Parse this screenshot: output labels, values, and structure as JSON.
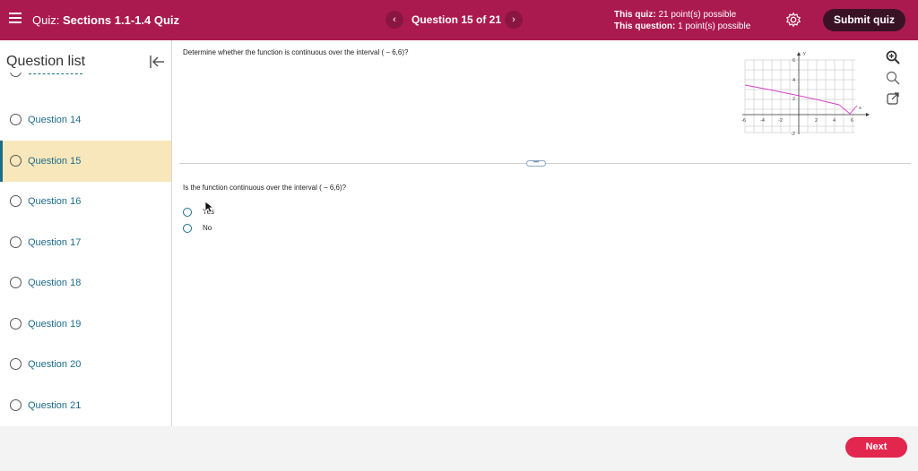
{
  "header": {
    "quiz_prefix": "Quiz:",
    "quiz_name": "Sections 1.1-1.4 Quiz",
    "question_counter": "Question 15 of 21",
    "prev_label": "‹",
    "next_label": "›",
    "this_quiz_label": "This quiz:",
    "this_quiz_value": "21 point(s) possible",
    "this_question_label": "This question:",
    "this_question_value": "1 point(s) possible",
    "submit_label": "Submit quiz"
  },
  "sidebar": {
    "title": "Question list",
    "items": [
      {
        "label": "Question 14"
      },
      {
        "label": "Question 15"
      },
      {
        "label": "Question 16"
      },
      {
        "label": "Question 17"
      },
      {
        "label": "Question 18"
      },
      {
        "label": "Question 19"
      },
      {
        "label": "Question 20"
      },
      {
        "label": "Question 21"
      }
    ]
  },
  "main": {
    "prompt": "Determine whether the function is continuous over the interval ( − 6,6)?",
    "divider_handle": "•••",
    "question": "Is the function continuous over the interval ( − 6,6)?",
    "answers": [
      {
        "label": "Yes"
      },
      {
        "label": "No"
      }
    ],
    "graph": {
      "x_label": "x",
      "y_label": "y",
      "x_ticks": [
        "-6",
        "-4",
        "-2",
        "2",
        "4",
        "6"
      ],
      "y_ticks": [
        "6",
        "4",
        "2",
        "-2"
      ],
      "curve_color": "#d63fc7"
    }
  },
  "footer": {
    "next_label": "Next"
  },
  "colors": {
    "header_bg": "#ab1a4e",
    "submit_bg": "#3a1226",
    "next_bg": "#e3264d",
    "active_item_bg": "#f8e7ba",
    "link_color": "#1d6c8c"
  }
}
